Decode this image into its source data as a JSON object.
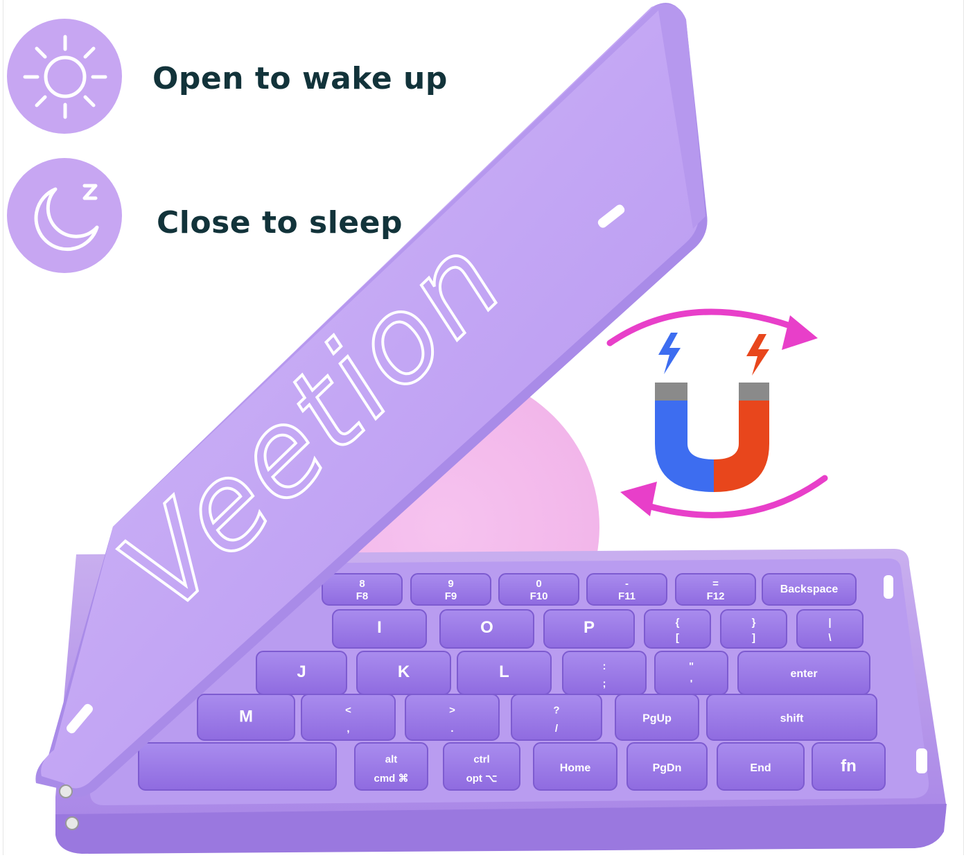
{
  "features": [
    {
      "label": "Open to wake up",
      "icon": "sun-icon"
    },
    {
      "label": "Close to sleep",
      "icon": "moon-sleep-icon"
    }
  ],
  "product": {
    "brand_logo": "Veetion",
    "magnet_icon": "magnet-icon",
    "cycle_arrows_icon": "rotate-arrows-icon"
  },
  "keyboard": {
    "rows": [
      [
        "8",
        "F8",
        "9",
        "F9",
        "0",
        "F10",
        "-",
        "F11",
        "=",
        "F12",
        "Backspace"
      ],
      [
        "I",
        "O",
        "P",
        "{",
        "[",
        "}",
        "]",
        "|",
        "\\"
      ],
      [
        "J",
        "K",
        "L",
        ":",
        ";",
        "\"",
        "'",
        "enter"
      ],
      [
        "M",
        "<",
        ",",
        ">",
        ".",
        "?",
        "/",
        "PgUp",
        "shift"
      ],
      [
        "alt",
        "cmd ⌘",
        "ctrl",
        "opt ⌥",
        "Home",
        "PgDn",
        "End",
        "fn"
      ]
    ]
  },
  "colors": {
    "accent_purple": "#c7a6f2",
    "keyboard_body": "#b394ee",
    "magnet_blue": "#3d6df0",
    "magnet_red": "#e8461c",
    "arrow_magenta": "#e83fc9",
    "text_dark": "#12333a"
  }
}
